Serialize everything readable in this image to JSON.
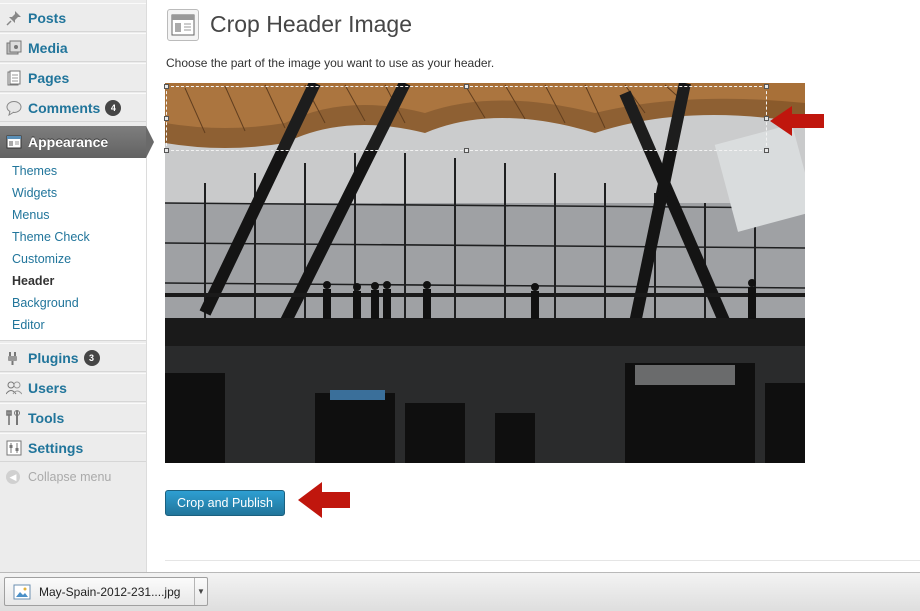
{
  "sidebar": {
    "items": [
      {
        "label": "Posts",
        "icon": "pin-icon"
      },
      {
        "label": "Media",
        "icon": "media-icon"
      },
      {
        "label": "Pages",
        "icon": "pages-icon"
      },
      {
        "label": "Comments",
        "icon": "comment-bubble-icon",
        "badge": "4"
      },
      {
        "label": "Appearance",
        "icon": "appearance-icon"
      },
      {
        "label": "Plugins",
        "icon": "plugin-icon",
        "badge": "3"
      },
      {
        "label": "Users",
        "icon": "users-icon"
      },
      {
        "label": "Tools",
        "icon": "tools-icon"
      },
      {
        "label": "Settings",
        "icon": "settings-icon"
      }
    ],
    "submenu": [
      "Themes",
      "Widgets",
      "Menus",
      "Theme Check",
      "Customize",
      "Header",
      "Background",
      "Editor"
    ],
    "current_submenu": "Header",
    "collapse_label": "Collapse menu"
  },
  "main": {
    "title": "Crop Header Image",
    "instruction": "Choose the part of the image you want to use as your header.",
    "crop_button": "Crop and Publish"
  },
  "download_bar": {
    "filename": "May-Spain-2012-231....jpg"
  },
  "colors": {
    "link": "#21759b",
    "button": "#21759b",
    "annotation_arrow": "#c0160d",
    "active_menu": "#6d6d6d"
  }
}
